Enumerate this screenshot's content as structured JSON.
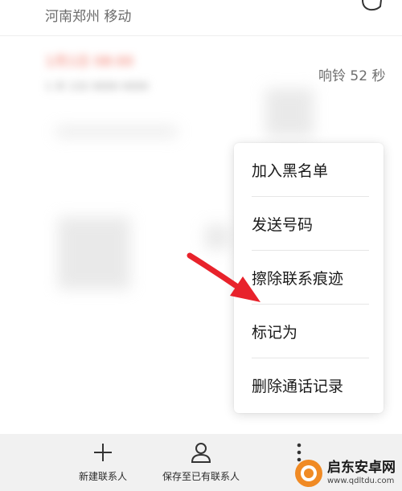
{
  "header": {
    "location": "河南郑州 移动",
    "message_icon": "message-bubble-icon"
  },
  "call_record": {
    "time": "1月1日 08:00",
    "subtitle": "1 天 132 0000 0000",
    "ring_duration": "响铃 52 秒"
  },
  "menu": {
    "items": [
      {
        "label": "加入黑名单"
      },
      {
        "label": "发送号码"
      },
      {
        "label": "擦除联系痕迹"
      },
      {
        "label": "标记为"
      },
      {
        "label": "删除通话记录"
      }
    ]
  },
  "annotation": {
    "arrow_color": "#e8222b",
    "arrow_icon": "red-arrow-pointer"
  },
  "toolbar": {
    "new_contact": {
      "label": "新建联系人",
      "icon": "plus-icon"
    },
    "save_existing": {
      "label": "保存至已有联系人",
      "icon": "person-icon"
    },
    "more": {
      "icon": "more-vertical-icon"
    }
  },
  "watermark": {
    "name": "启东安卓网",
    "url": "www.qdltdu.com",
    "logo_color": "#f08a24"
  }
}
